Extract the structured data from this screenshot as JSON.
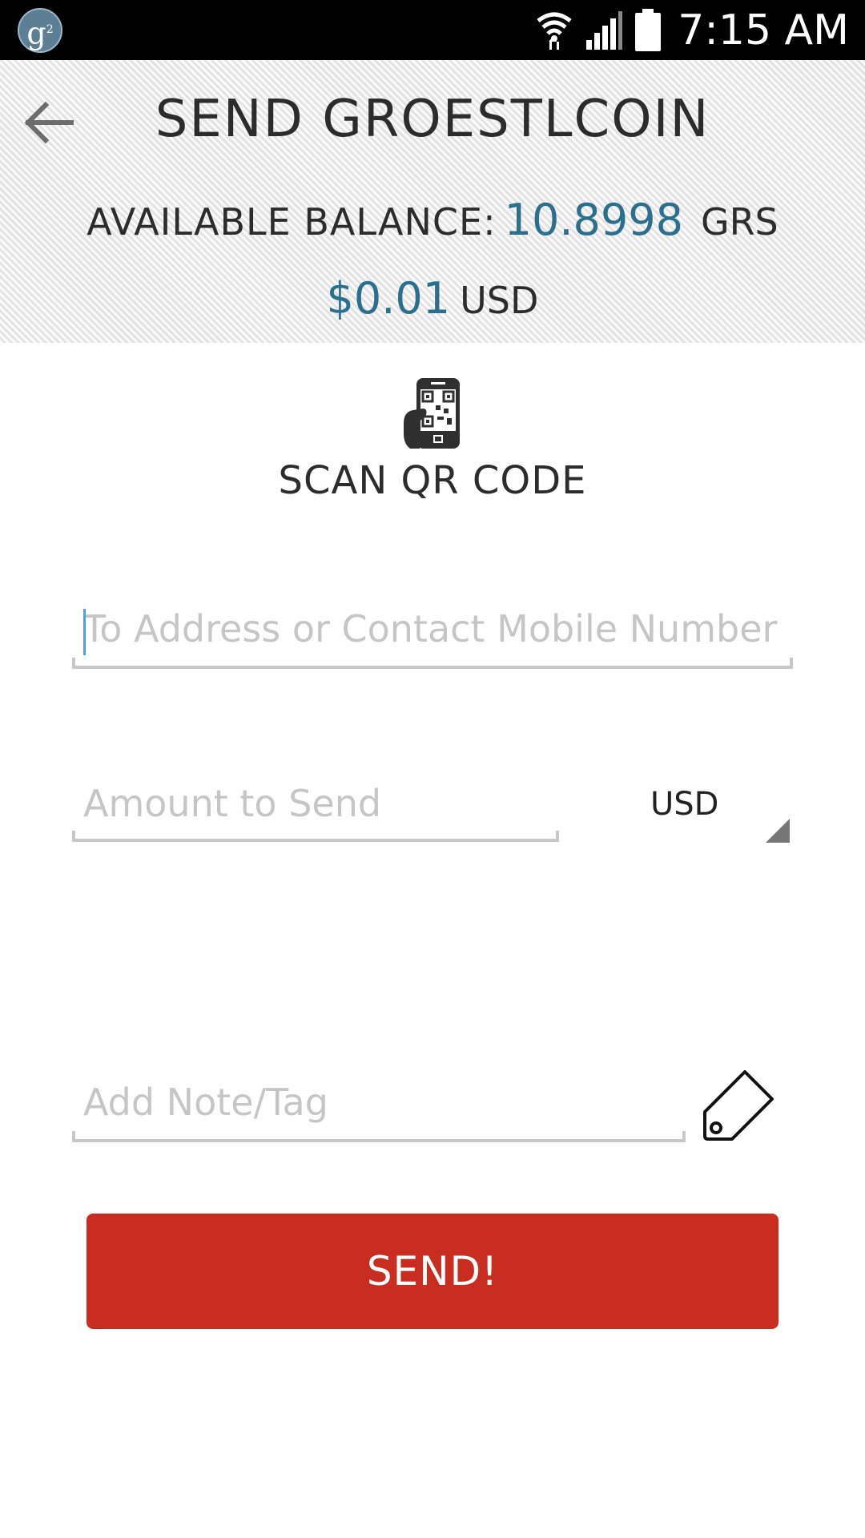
{
  "status_bar": {
    "app_icon": "groestlcoin-logo-icon",
    "app_icon_letter": "g",
    "time": "7:15 AM",
    "icons": [
      "wifi-icon",
      "signal-icon",
      "battery-icon"
    ]
  },
  "header": {
    "back_icon": "arrow-left-icon",
    "title": "SEND GROESTLCOIN",
    "balance_label": "AVAILABLE BALANCE:",
    "balance_value": "10.8998",
    "balance_unit": "GRS",
    "fiat_value": "$0.01",
    "fiat_unit": "USD"
  },
  "scan": {
    "icon": "phone-qr-code-icon",
    "label": "SCAN QR CODE"
  },
  "form": {
    "to_address": {
      "value": "",
      "placeholder": "To Address or Contact Mobile Number"
    },
    "amount": {
      "value": "",
      "placeholder": "Amount to Send"
    },
    "currency": {
      "selected": "USD"
    },
    "note": {
      "value": "",
      "placeholder": "Add Note/Tag",
      "icon": "tag-icon"
    }
  },
  "send_button": {
    "label": "SEND!"
  },
  "colors": {
    "accent_blue": "#2a6f8e",
    "send_red": "#c82d20",
    "status_bar": "#000000",
    "field_underline": "#c8c8c8",
    "placeholder": "#c6c6c6"
  }
}
